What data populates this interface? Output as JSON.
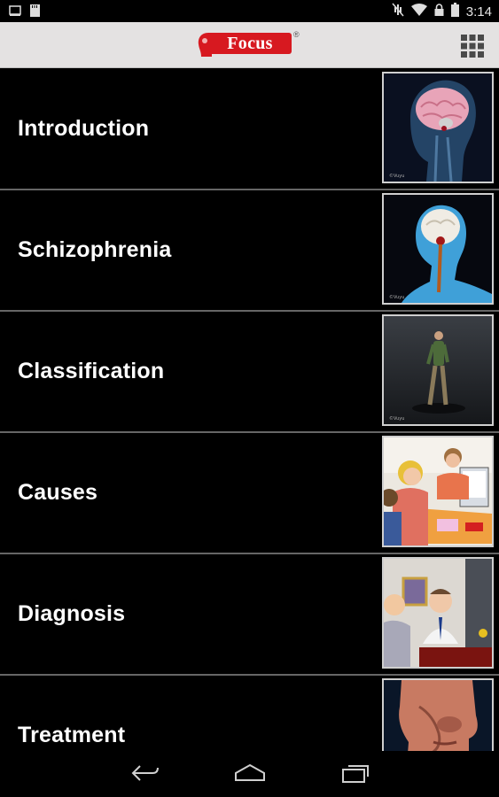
{
  "status_bar": {
    "time": "3:14",
    "icons": [
      "gallery-notification-icon",
      "sd-card-icon",
      "mute-icon",
      "wifi-icon",
      "lock-icon",
      "battery-icon"
    ]
  },
  "header": {
    "logo_text": "Focus",
    "logo_reg": "®",
    "menu_icon": "grid-menu-icon",
    "brand_color": "#d71920"
  },
  "topics": [
    {
      "label": "Introduction",
      "thumb": "brain-head-thumbnail"
    },
    {
      "label": "Schizophrenia",
      "thumb": "head-neck-anatomy-thumbnail"
    },
    {
      "label": "Classification",
      "thumb": "walking-man-thumbnail"
    },
    {
      "label": "Causes",
      "thumb": "family-meeting-thumbnail"
    },
    {
      "label": "Diagnosis",
      "thumb": "doctor-consultation-thumbnail"
    },
    {
      "label": "Treatment",
      "thumb": "face-profile-thumbnail"
    }
  ],
  "nav": {
    "back": "back-icon",
    "home": "home-icon",
    "recents": "recents-icon"
  }
}
